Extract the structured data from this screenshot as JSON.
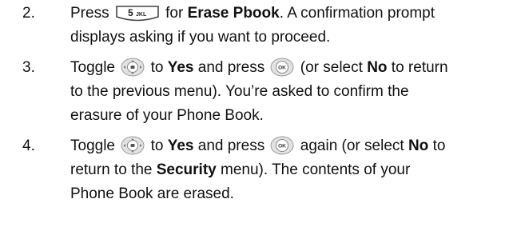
{
  "steps": [
    {
      "number": "2.",
      "line1_pre": "Press",
      "key_label": "5",
      "key_sub_label": "JKL",
      "line1_mid": "for",
      "line1_bold": "Erase Pbook",
      "line1_post": ". A confirmation prompt",
      "line2": "displays asking if you want to proceed."
    },
    {
      "number": "3.",
      "line1_pre": "Toggle",
      "line1_mid": "to",
      "line1_bold1": "Yes",
      "line1_mid2": "and press",
      "line1_mid3": "(or select",
      "line1_bold2": "No",
      "line1_post": "to return",
      "line2": "to the previous menu). You’re asked to confirm the",
      "line3": "erasure of your Phone Book."
    },
    {
      "number": "4.",
      "line1_pre": "Toggle",
      "line1_mid": "to",
      "line1_bold1": "Yes",
      "line1_mid2": "and press",
      "line1_mid3": "again (or select",
      "line1_bold2": "No",
      "line1_post": "to",
      "line2_pre": "return to the",
      "line2_bold": "Security",
      "line2_post": "menu). The contents of your",
      "line3": "Phone Book are erased."
    }
  ],
  "icons": {
    "ok_key_label": "OK",
    "nav_key": "navigation-key-icon",
    "ok_key": "ok-key-icon",
    "number_key": "number-5-key-icon"
  }
}
